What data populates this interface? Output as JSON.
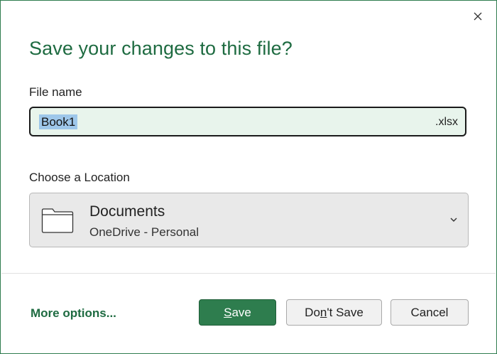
{
  "dialog": {
    "title": "Save your changes to this file?",
    "close_icon": "close-icon"
  },
  "file": {
    "label": "File name",
    "value": "Book1",
    "extension": ".xlsx"
  },
  "location": {
    "label": "Choose a Location",
    "name": "Documents",
    "subtitle": "OneDrive - Personal",
    "icon": "folder-icon",
    "dropdown_icon": "chevron-down-icon"
  },
  "footer": {
    "more_options": "More options...",
    "save": {
      "accel": "S",
      "rest": "ave"
    },
    "dont_save": {
      "pre": "Do",
      "accel": "n",
      "rest": "'t Save"
    },
    "cancel": "Cancel"
  },
  "colors": {
    "accent": "#2e7d4e",
    "title": "#1e6b41",
    "selection": "#9ec7ea",
    "input_bg": "#e8f4ec"
  }
}
